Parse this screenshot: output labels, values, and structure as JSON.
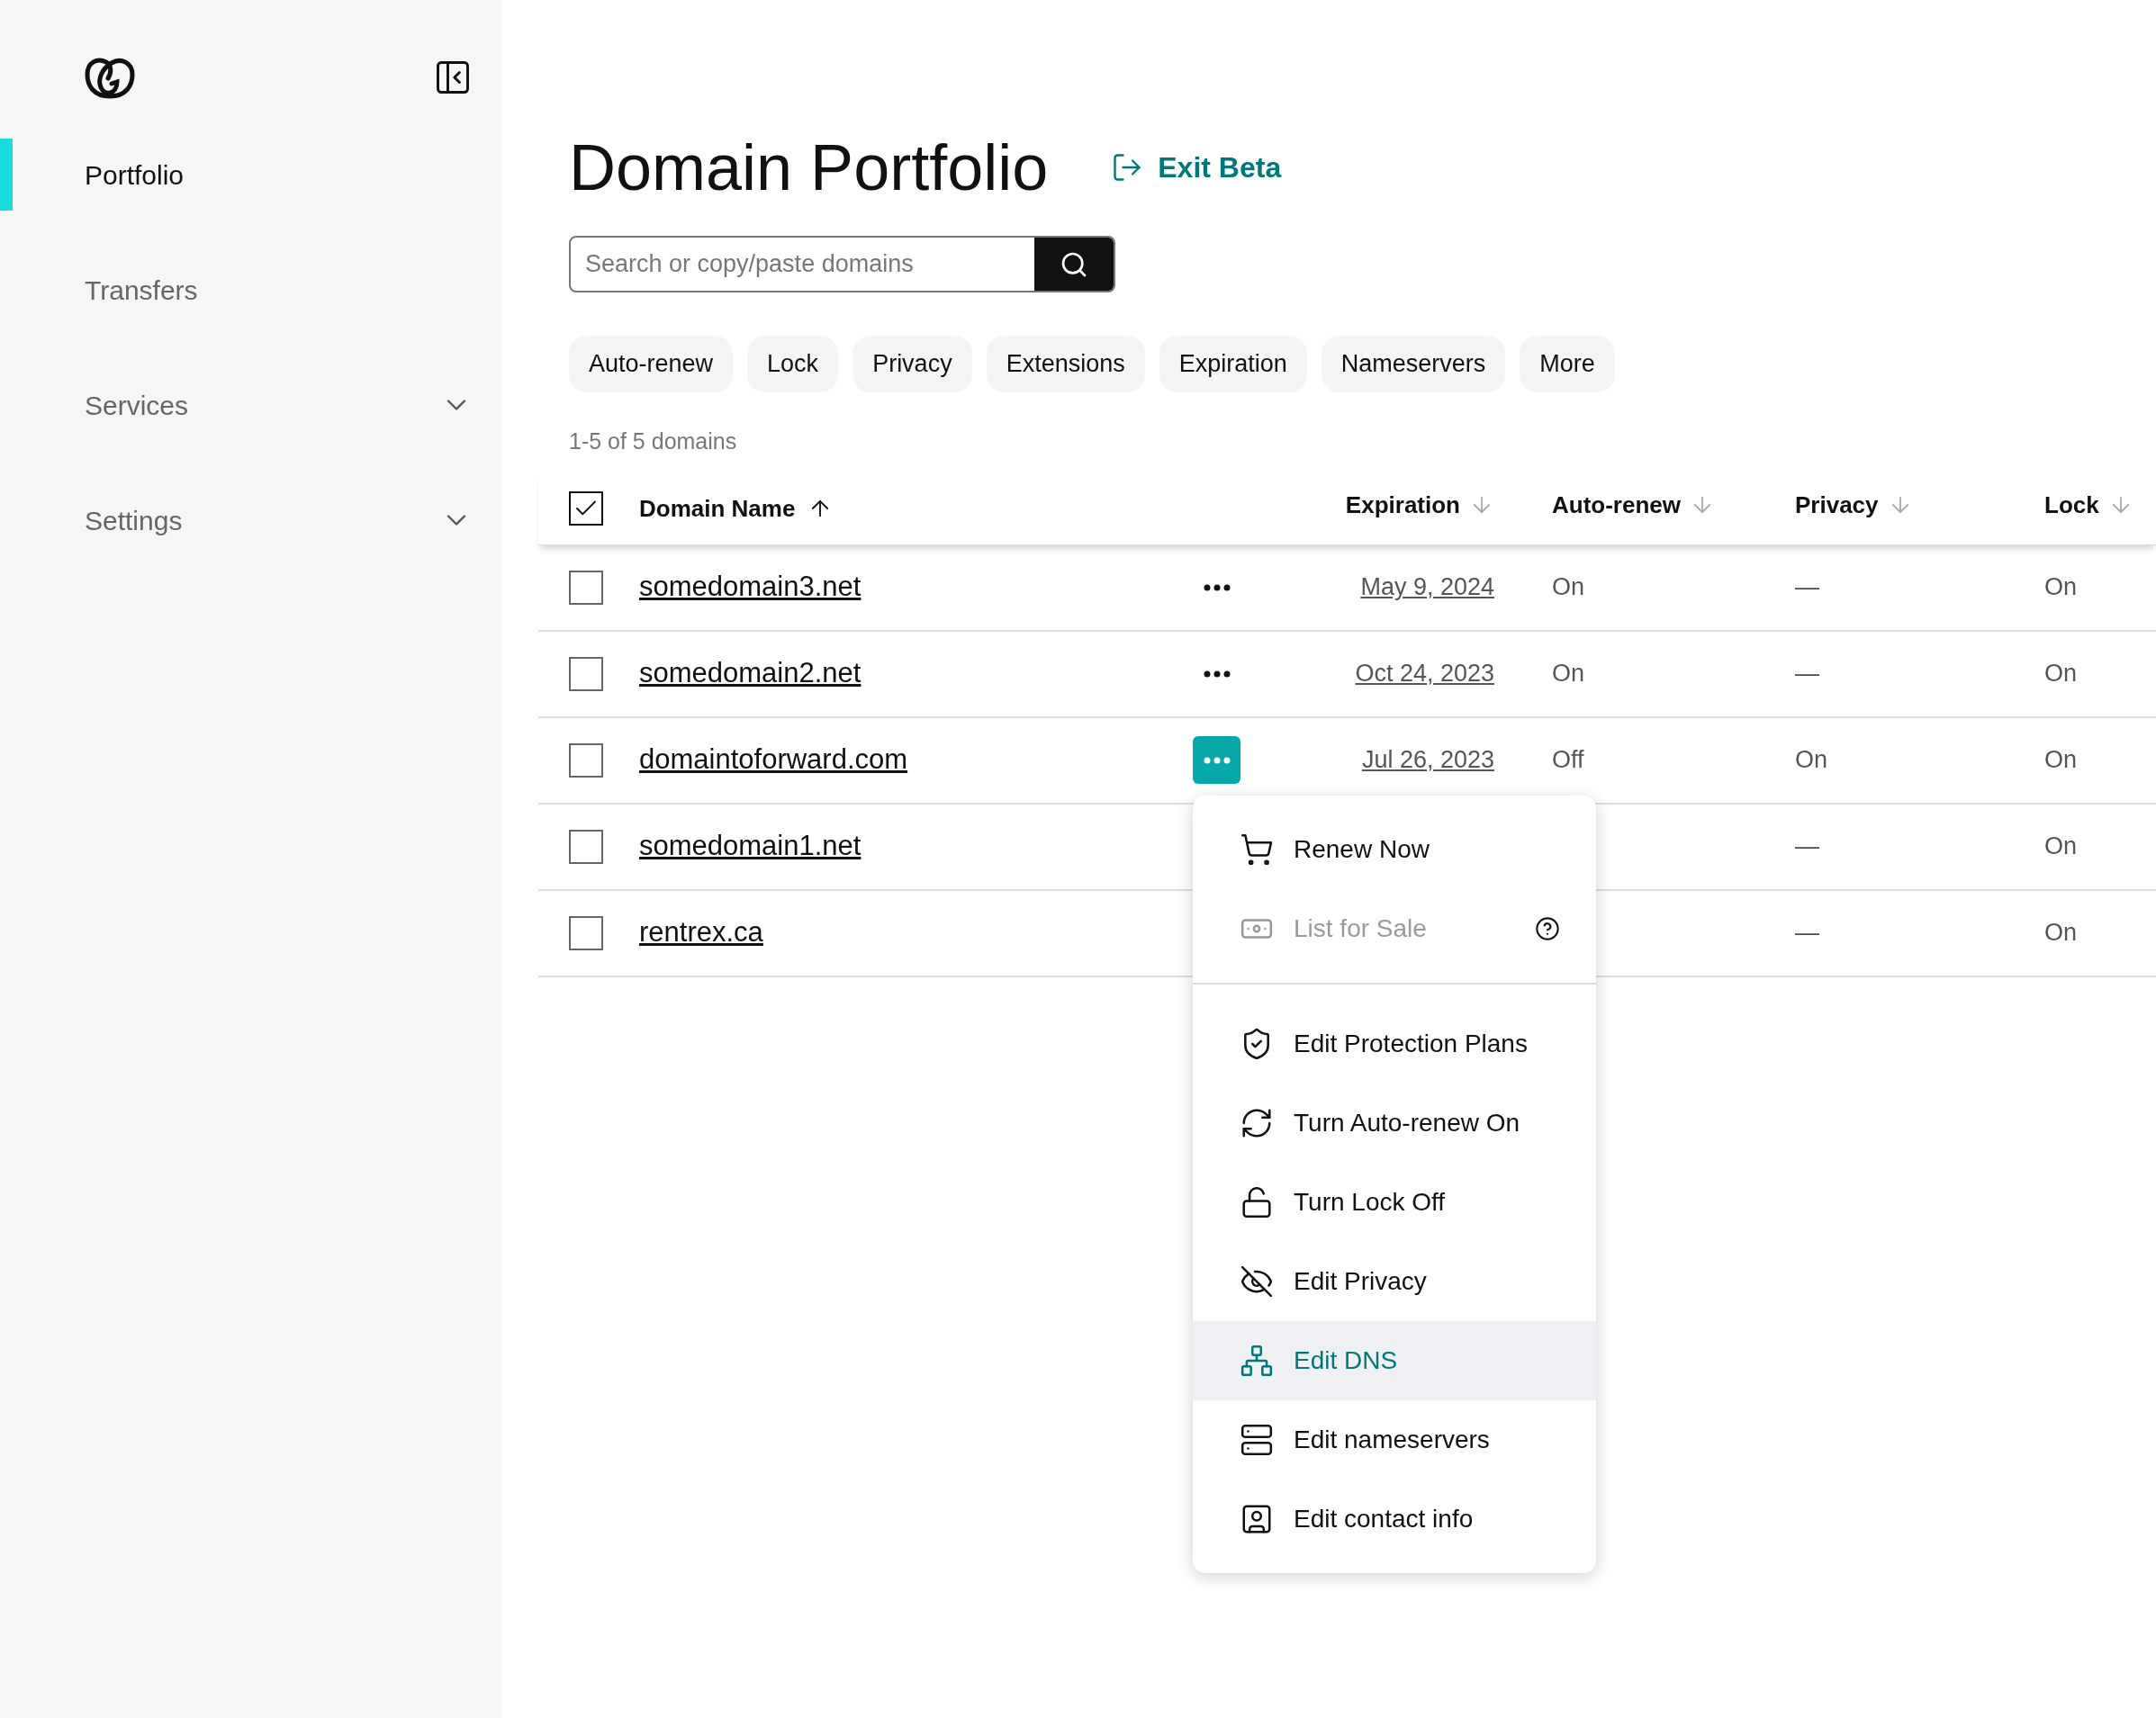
{
  "sidebar": {
    "nav": [
      {
        "label": "Portfolio",
        "kind": "link",
        "selected": true
      },
      {
        "label": "Transfers",
        "kind": "link",
        "selected": false
      },
      {
        "label": "Services",
        "kind": "expandable",
        "selected": false
      },
      {
        "label": "Settings",
        "kind": "expandable",
        "selected": false
      }
    ]
  },
  "header": {
    "title": "Domain Portfolio",
    "exit_link": "Exit Beta"
  },
  "search": {
    "placeholder": "Search or copy/paste domains"
  },
  "filters": [
    "Auto-renew",
    "Lock",
    "Privacy",
    "Extensions",
    "Expiration",
    "Nameservers",
    "More"
  ],
  "count": "1-5 of 5 domains",
  "table": {
    "select_all_checked": true,
    "columns": [
      {
        "label": "Domain Name",
        "sorted_ascending": true
      },
      {
        "label": "Expiration",
        "sorted_ascending": false
      },
      {
        "label": "Auto-renew",
        "sorted_ascending": false
      },
      {
        "label": "Privacy",
        "sorted_ascending": false
      },
      {
        "label": "Lock",
        "sorted_ascending": false
      }
    ],
    "rows": [
      {
        "domain": "somedomain3.net",
        "checked": false,
        "menu_open": false,
        "expiration": "May 9, 2024",
        "auto_renew": "On",
        "privacy": "—",
        "lock": "On"
      },
      {
        "domain": "somedomain2.net",
        "checked": false,
        "menu_open": false,
        "expiration": "Oct 24, 2023",
        "auto_renew": "On",
        "privacy": "—",
        "lock": "On"
      },
      {
        "domain": "domaintoforward.com",
        "checked": false,
        "menu_open": true,
        "expiration": "Jul 26, 2023",
        "auto_renew": "Off",
        "privacy": "On",
        "lock": "On"
      },
      {
        "domain": "somedomain1.net",
        "checked": false,
        "menu_open": false,
        "privacy": "—",
        "lock": "On"
      },
      {
        "domain": "rentrex.ca",
        "checked": false,
        "menu_open": false,
        "privacy": "—",
        "lock": "On"
      }
    ]
  },
  "menu": {
    "groups": [
      [
        {
          "label": "Renew Now",
          "kind": "cart",
          "disabled": false,
          "selected": false
        },
        {
          "label": "List for Sale",
          "kind": "cash",
          "disabled": true,
          "selected": false,
          "help": true
        }
      ],
      [
        {
          "label": "Edit Protection Plans",
          "kind": "shield",
          "disabled": false,
          "selected": false
        },
        {
          "label": "Turn Auto-renew On",
          "kind": "refresh",
          "disabled": false,
          "selected": false
        },
        {
          "label": "Turn Lock Off",
          "kind": "unlock",
          "disabled": false,
          "selected": false
        },
        {
          "label": "Edit Privacy",
          "kind": "eye-off",
          "disabled": false,
          "selected": false
        },
        {
          "label": "Edit DNS",
          "kind": "network",
          "disabled": false,
          "selected": true
        },
        {
          "label": "Edit nameservers",
          "kind": "server",
          "disabled": false,
          "selected": false
        },
        {
          "label": "Edit contact info",
          "kind": "contact",
          "disabled": false,
          "selected": false
        }
      ]
    ]
  }
}
